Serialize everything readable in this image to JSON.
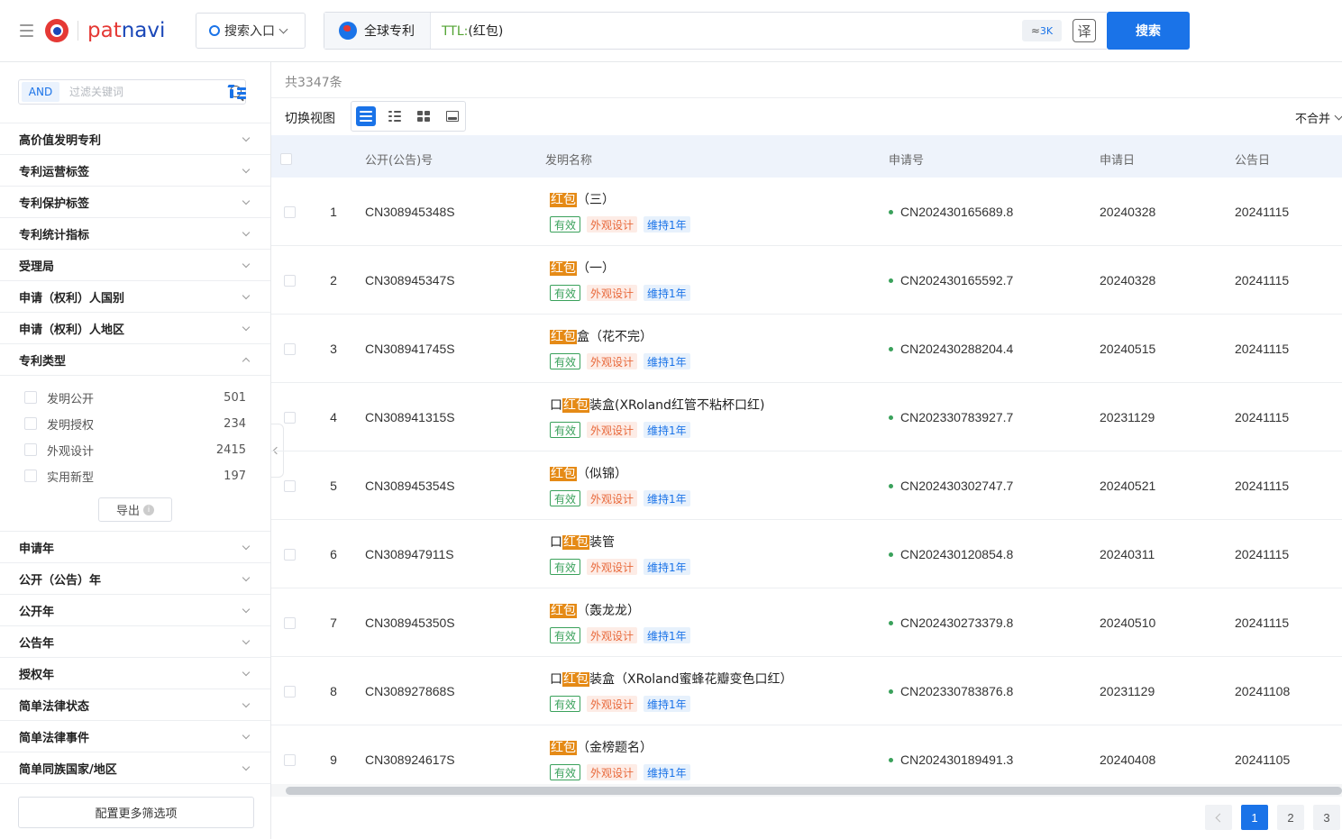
{
  "header": {
    "logo_text_a": "pat",
    "logo_text_b": "navi",
    "entry_label": "搜索入口",
    "scope_label": "全球专利",
    "query_field": "TTL:",
    "query_value": "(红包)",
    "approx_prefix": "≈",
    "approx_value": "3K",
    "translate_label": "译",
    "search_button": "搜索"
  },
  "sidebar": {
    "and_label": "AND",
    "filter_placeholder": "过滤关键词",
    "groups_top": [
      "高价值发明专利",
      "专利运营标签",
      "专利保护标签",
      "专利统计指标",
      "受理局",
      "申请（权利）人国别",
      "申请（权利）人地区"
    ],
    "expanded_group": "专利类型",
    "types": [
      {
        "label": "发明公开",
        "count": "501"
      },
      {
        "label": "发明授权",
        "count": "234"
      },
      {
        "label": "外观设计",
        "count": "2415"
      },
      {
        "label": "实用新型",
        "count": "197"
      }
    ],
    "export_label": "导出",
    "export_info": "i",
    "groups_bottom": [
      "申请年",
      "公开（公告）年",
      "公开年",
      "公告年",
      "授权年",
      "简单法律状态",
      "简单法律事件",
      "简单同族国家/地区"
    ],
    "config_button": "配置更多筛选项"
  },
  "main": {
    "total": "共3347条",
    "switch_label": "切换视图",
    "merge_label": "不合并",
    "columns": [
      "公开(公告)号",
      "发明名称",
      "申请号",
      "申请日",
      "公告日"
    ],
    "tag_labels": [
      "有效",
      "外观设计",
      "维持1年"
    ],
    "rows": [
      {
        "idx": "1",
        "pub": "CN308945348S",
        "pre": "",
        "hl": "红包",
        "post": "（三）",
        "app": "CN202430165689.8",
        "app_date": "20240328",
        "pub_date": "20241115"
      },
      {
        "idx": "2",
        "pub": "CN308945347S",
        "pre": "",
        "hl": "红包",
        "post": "（一）",
        "app": "CN202430165592.7",
        "app_date": "20240328",
        "pub_date": "20241115"
      },
      {
        "idx": "3",
        "pub": "CN308941745S",
        "pre": "",
        "hl": "红包",
        "post": "盒（花不完）",
        "app": "CN202430288204.4",
        "app_date": "20240515",
        "pub_date": "20241115"
      },
      {
        "idx": "4",
        "pub": "CN308941315S",
        "pre": "口",
        "hl": "红包",
        "post": "装盒(XRoland红管不粘杯口红)",
        "app": "CN202330783927.7",
        "app_date": "20231129",
        "pub_date": "20241115"
      },
      {
        "idx": "5",
        "pub": "CN308945354S",
        "pre": "",
        "hl": "红包",
        "post": "（似锦）",
        "app": "CN202430302747.7",
        "app_date": "20240521",
        "pub_date": "20241115"
      },
      {
        "idx": "6",
        "pub": "CN308947911S",
        "pre": "口",
        "hl": "红包",
        "post": "装管",
        "app": "CN202430120854.8",
        "app_date": "20240311",
        "pub_date": "20241115"
      },
      {
        "idx": "7",
        "pub": "CN308945350S",
        "pre": "",
        "hl": "红包",
        "post": "（轰龙龙）",
        "app": "CN202430273379.8",
        "app_date": "20240510",
        "pub_date": "20241115"
      },
      {
        "idx": "8",
        "pub": "CN308927868S",
        "pre": "口",
        "hl": "红包",
        "post": "装盒（XRoland蜜蜂花瓣变色口红）",
        "app": "CN202330783876.8",
        "app_date": "20231129",
        "pub_date": "20241108"
      },
      {
        "idx": "9",
        "pub": "CN308924617S",
        "pre": "",
        "hl": "红包",
        "post": "（金榜题名）",
        "app": "CN202430189491.3",
        "app_date": "20240408",
        "pub_date": "20241105"
      }
    ],
    "pages": [
      "1",
      "2",
      "3"
    ],
    "current_page": "1"
  },
  "colors": {
    "accent": "#1a73e8",
    "highlight": "#e58a16",
    "valid": "#3aa15b",
    "brand_red": "#e53935"
  }
}
